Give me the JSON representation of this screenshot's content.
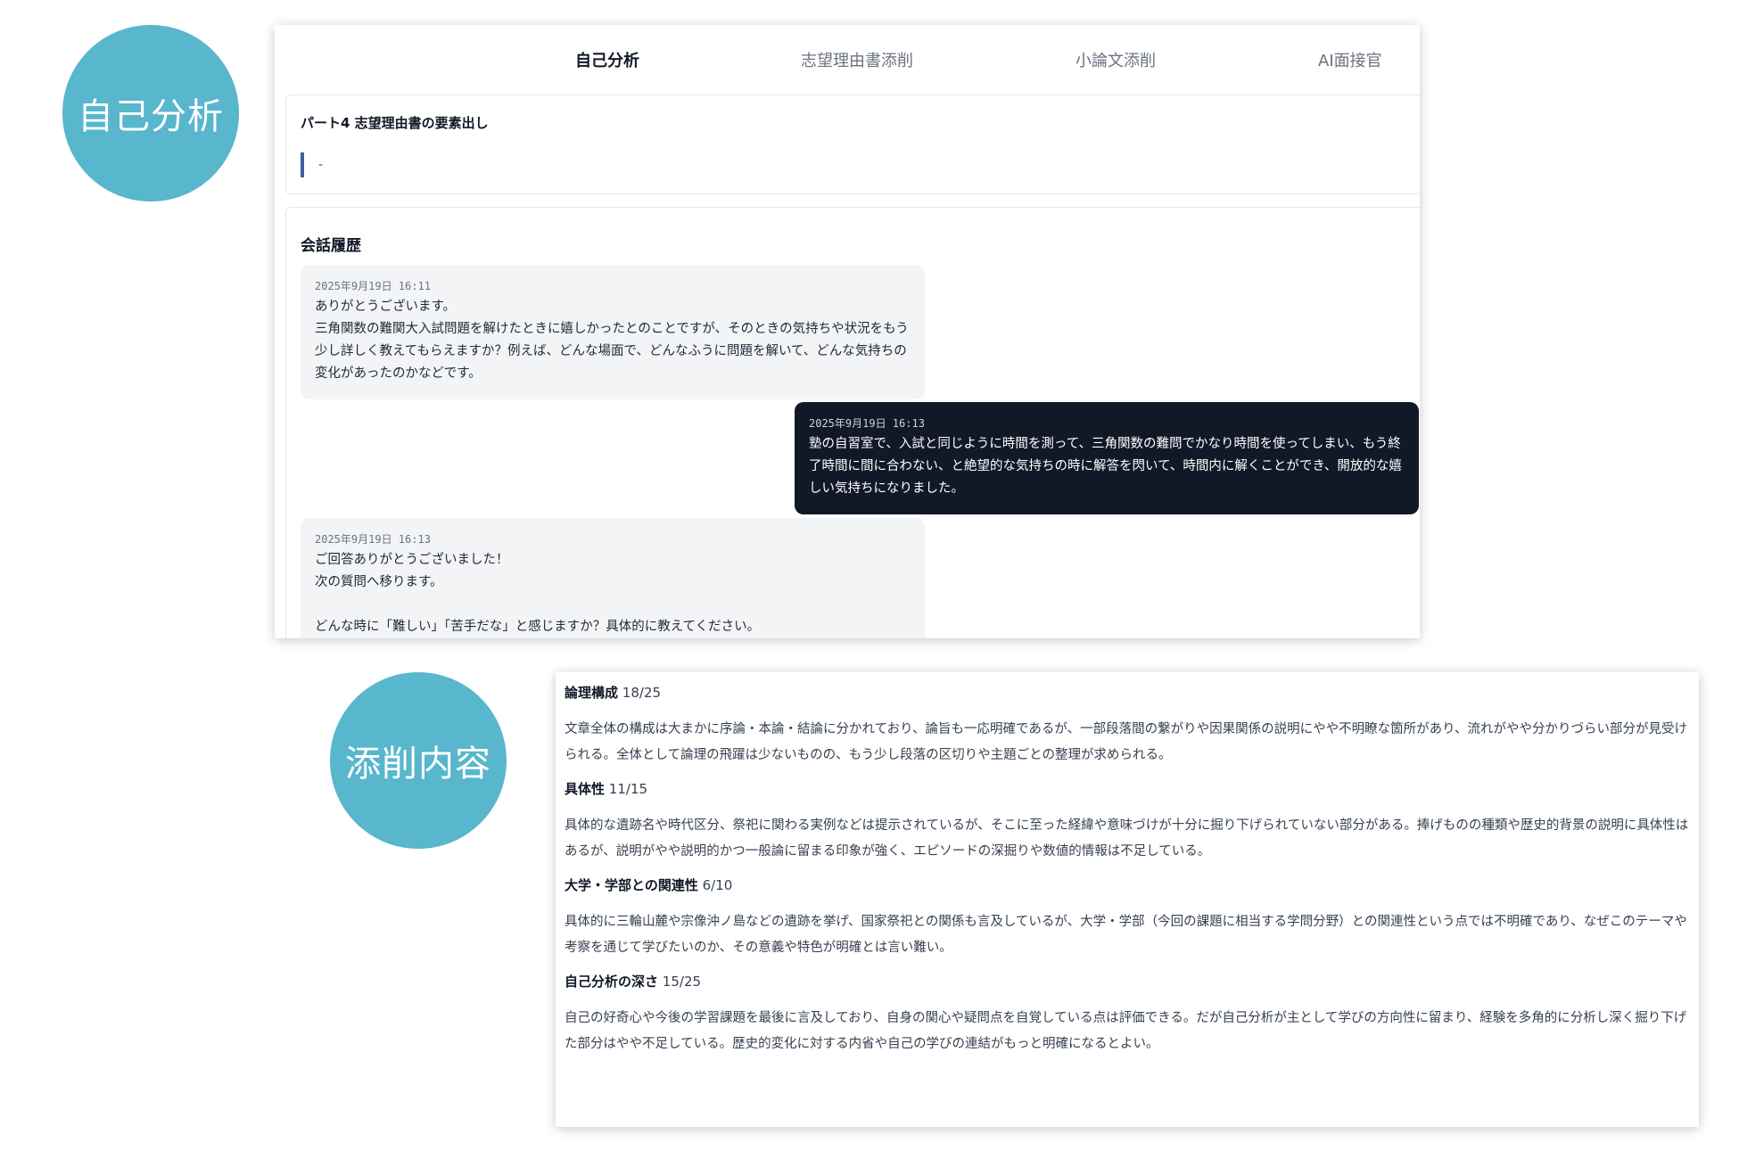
{
  "labels": {
    "self_analysis": "自己分析",
    "review_content": "添削内容"
  },
  "tabs": [
    {
      "label": "自己分析",
      "active": true
    },
    {
      "label": "志望理由書添削",
      "active": false
    },
    {
      "label": "小論文添削",
      "active": false
    },
    {
      "label": "AI面接官",
      "active": false
    }
  ],
  "part": {
    "title": "パート4 志望理由書の要素出し",
    "quote": "-"
  },
  "history": {
    "title": "会話履歴",
    "messages": [
      {
        "role": "ai",
        "timestamp": "2025年9月19日 16:11",
        "text": "ありがとうございます。\n三角関数の難関大入試問題を解けたときに嬉しかったとのことですが、そのときの気持ちや状況をもう少し詳しく教えてもらえますか？例えば、どんな場面で、どんなふうに問題を解いて、どんな気持ちの変化があったのかなどです。"
      },
      {
        "role": "user",
        "timestamp": "2025年9月19日 16:13",
        "text": "塾の自習室で、入試と同じように時間を測って、三角関数の難問でかなり時間を使ってしまい、もう終了時間に間に合わない、と絶望的な気持ちの時に解答を閃いて、時間内に解くことができ、開放的な嬉しい気持ちになりました。"
      },
      {
        "role": "ai",
        "timestamp": "2025年9月19日 16:13",
        "text": "ご回答ありがとうございました！\n次の質問へ移ります。\n\nどんな時に「難しい」「苦手だな」と感じますか？具体的に教えてください。"
      }
    ]
  },
  "review": {
    "sections": [
      {
        "name": "論理構成",
        "score": "18/25",
        "body": "文章全体の構成は大まかに序論・本論・結論に分かれており、論旨も一応明確であるが、一部段落間の繋がりや因果関係の説明にやや不明瞭な箇所があり、流れがやや分かりづらい部分が見受けられる。全体として論理の飛躍は少ないものの、もう少し段落の区切りや主題ごとの整理が求められる。"
      },
      {
        "name": "具体性",
        "score": "11/15",
        "body": "具体的な遺跡名や時代区分、祭祀に関わる実例などは提示されているが、そこに至った経緯や意味づけが十分に掘り下げられていない部分がある。捧げものの種類や歴史的背景の説明に具体性はあるが、説明がやや説明的かつ一般論に留まる印象が強く、エピソードの深掘りや数値的情報は不足している。"
      },
      {
        "name": "大学・学部との関連性",
        "score": "6/10",
        "body": "具体的に三輪山麓や宗像沖ノ島などの遺跡を挙げ、国家祭祀との関係も言及しているが、大学・学部（今回の課題に相当する学問分野）との関連性という点では不明確であり、なぜこのテーマや考察を通じて学びたいのか、その意義や特色が明確とは言い難い。"
      },
      {
        "name": "自己分析の深さ",
        "score": "15/25",
        "body": "自己の好奇心や今後の学習課題を最後に言及しており、自身の関心や疑問点を自覚している点は評価できる。だが自己分析が主として学びの方向性に留まり、経験を多角的に分析し深く掘り下げた部分はやや不足している。歴史的変化に対する内省や自己の学びの連結がもっと明確になるとよい。"
      }
    ]
  }
}
